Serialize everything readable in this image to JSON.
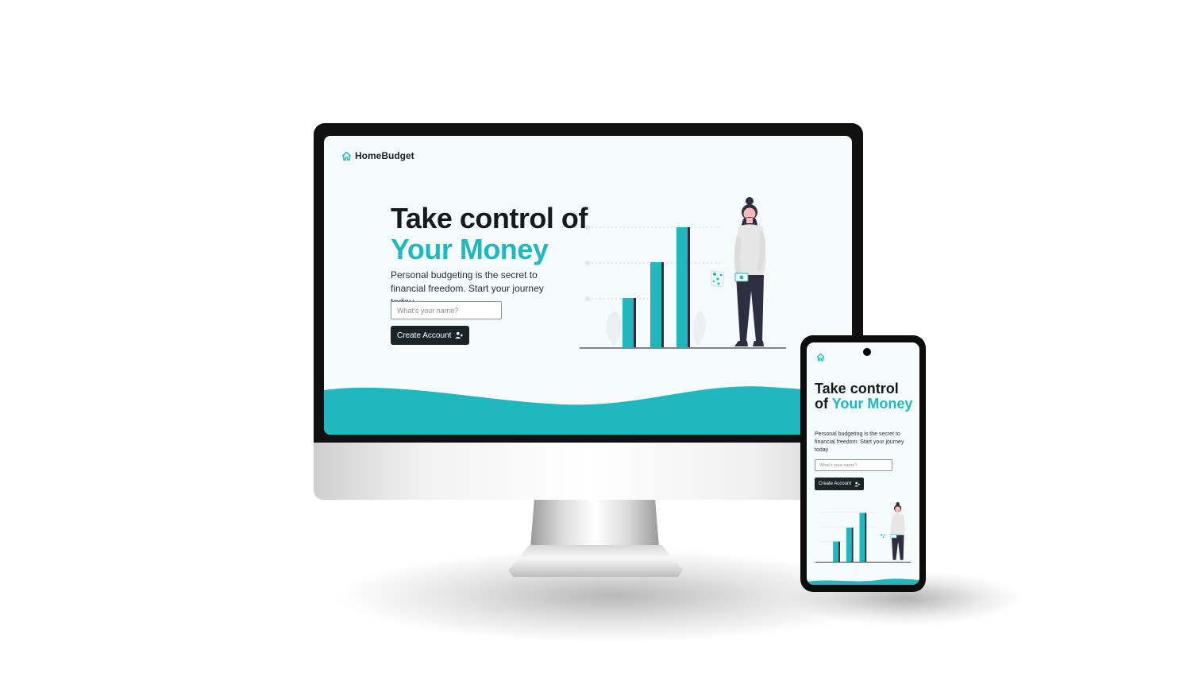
{
  "brand": {
    "name": "HomeBudget",
    "logo_icon": "house-icon",
    "accent_color": "#20b7bf",
    "dark_color": "#1b2428"
  },
  "hero": {
    "title_line1": "Take control of",
    "title_accent": "Your Money",
    "description": "Personal budgeting is the secret to financial freedom. Start your journey today",
    "name_placeholder": "What's your name?",
    "button_label": "Create Account",
    "button_icon": "user-plus-icon"
  },
  "mobile": {
    "title_line1": "Take control of",
    "title_accent": "Your Money",
    "description": "Personal budgeting is the secret to financial freedom. Start your journey today",
    "name_placeholder": "What's your name?",
    "button_label": "Create Account"
  }
}
